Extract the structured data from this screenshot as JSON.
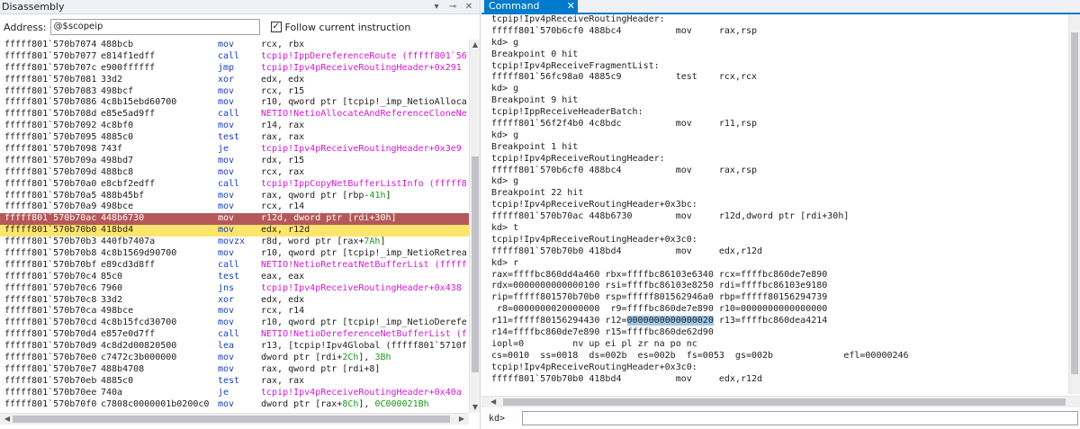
{
  "disassembly": {
    "title": "Disassembly",
    "address_label": "Address:",
    "address_value": "@$scopeip",
    "follow_label": "Follow current instruction",
    "follow_checked": "✓",
    "rows": [
      {
        "addr": "fffff801`570b7074",
        "bytes": "488bcb",
        "mn": "mov",
        "op": [
          {
            "t": "rcx, rbx",
            "c": ""
          }
        ]
      },
      {
        "addr": "fffff801`570b7077",
        "bytes": "e814f1edff",
        "mn": "call",
        "op": [
          {
            "t": "tcpip!IppDereferenceRoute (fffff801`56",
            "c": "mag"
          }
        ]
      },
      {
        "addr": "fffff801`570b707c",
        "bytes": "e900ffffff",
        "mn": "jmp",
        "op": [
          {
            "t": "tcpip!Ipv4pReceiveRoutingHeader+0x291",
            "c": "mag"
          }
        ]
      },
      {
        "addr": "fffff801`570b7081",
        "bytes": "33d2",
        "mn": "xor",
        "op": [
          {
            "t": "edx, edx",
            "c": ""
          }
        ]
      },
      {
        "addr": "fffff801`570b7083",
        "bytes": "498bcf",
        "mn": "mov",
        "op": [
          {
            "t": "rcx, r15",
            "c": ""
          }
        ]
      },
      {
        "addr": "fffff801`570b7086",
        "bytes": "4c8b15ebd60700",
        "mn": "mov",
        "op": [
          {
            "t": "r10, qword ptr [tcpip!_imp_NetioAlloca",
            "c": ""
          }
        ]
      },
      {
        "addr": "fffff801`570b708d",
        "bytes": "e85e5ad9ff",
        "mn": "call",
        "op": [
          {
            "t": "NETIO!NetioAllocateAndReferenceCloneNe",
            "c": "mag"
          }
        ]
      },
      {
        "addr": "fffff801`570b7092",
        "bytes": "4c8bf0",
        "mn": "mov",
        "op": [
          {
            "t": "r14, rax",
            "c": ""
          }
        ]
      },
      {
        "addr": "fffff801`570b7095",
        "bytes": "4885c0",
        "mn": "test",
        "op": [
          {
            "t": "rax, rax",
            "c": ""
          }
        ]
      },
      {
        "addr": "fffff801`570b7098",
        "bytes": "743f",
        "mn": "je",
        "op": [
          {
            "t": "tcpip!Ipv4pReceiveRoutingHeader+0x3e9",
            "c": "mag"
          }
        ]
      },
      {
        "addr": "fffff801`570b709a",
        "bytes": "498bd7",
        "mn": "mov",
        "op": [
          {
            "t": "rdx, r15",
            "c": ""
          }
        ]
      },
      {
        "addr": "fffff801`570b709d",
        "bytes": "488bc8",
        "mn": "mov",
        "op": [
          {
            "t": "rcx, rax",
            "c": ""
          }
        ]
      },
      {
        "addr": "fffff801`570b70a0",
        "bytes": "e8cbf2edff",
        "mn": "call",
        "op": [
          {
            "t": "tcpip!IppCopyNetBufferListInfo (fffff8",
            "c": "mag"
          }
        ]
      },
      {
        "addr": "fffff801`570b70a5",
        "bytes": "488b45bf",
        "mn": "mov",
        "op": [
          {
            "t": "rax, qword ptr [rbp-",
            "c": ""
          },
          {
            "t": "41h",
            "c": "grn"
          },
          {
            "t": "]",
            "c": ""
          }
        ]
      },
      {
        "addr": "fffff801`570b70a9",
        "bytes": "498bce",
        "mn": "mov",
        "op": [
          {
            "t": "rcx, r14",
            "c": ""
          }
        ]
      },
      {
        "addr": "fffff801`570b70ac",
        "bytes": "448b6730",
        "mn": "mov",
        "op": [
          {
            "t": "r12d, dword ptr [rdi+30h]",
            "c": ""
          }
        ],
        "state": "cur"
      },
      {
        "addr": "fffff801`570b70b0",
        "bytes": "418bd4",
        "mn": "mov",
        "op": [
          {
            "t": "edx, r12d",
            "c": ""
          }
        ],
        "state": "next"
      },
      {
        "addr": "fffff801`570b70b3",
        "bytes": "440fb7407a",
        "mn": "movzx",
        "op": [
          {
            "t": "r8d, word ptr [rax+",
            "c": ""
          },
          {
            "t": "7Ah",
            "c": "grn"
          },
          {
            "t": "]",
            "c": ""
          }
        ]
      },
      {
        "addr": "fffff801`570b70b8",
        "bytes": "4c8b1569d90700",
        "mn": "mov",
        "op": [
          {
            "t": "r10, qword ptr [tcpip!_imp_NetioRetrea",
            "c": ""
          }
        ]
      },
      {
        "addr": "fffff801`570b70bf",
        "bytes": "e89cd3d8ff",
        "mn": "call",
        "op": [
          {
            "t": "NETIO!NetioRetreatNetBufferList (fffff",
            "c": "mag"
          }
        ]
      },
      {
        "addr": "fffff801`570b70c4",
        "bytes": "85c0",
        "mn": "test",
        "op": [
          {
            "t": "eax, eax",
            "c": ""
          }
        ]
      },
      {
        "addr": "fffff801`570b70c6",
        "bytes": "7960",
        "mn": "jns",
        "op": [
          {
            "t": "tcpip!Ipv4pReceiveRoutingHeader+0x438",
            "c": "mag"
          }
        ]
      },
      {
        "addr": "fffff801`570b70c8",
        "bytes": "33d2",
        "mn": "xor",
        "op": [
          {
            "t": "edx, edx",
            "c": ""
          }
        ]
      },
      {
        "addr": "fffff801`570b70ca",
        "bytes": "498bce",
        "mn": "mov",
        "op": [
          {
            "t": "rcx, r14",
            "c": ""
          }
        ]
      },
      {
        "addr": "fffff801`570b70cd",
        "bytes": "4c8b15fcd30700",
        "mn": "mov",
        "op": [
          {
            "t": "r10, qword ptr [tcpip!_imp_NetioDerefe",
            "c": ""
          }
        ]
      },
      {
        "addr": "fffff801`570b70d4",
        "bytes": "e857e0d7ff",
        "mn": "call",
        "op": [
          {
            "t": "NETIO!NetioDereferenceNetBufferList (f",
            "c": "mag"
          }
        ]
      },
      {
        "addr": "fffff801`570b70d9",
        "bytes": "4c8d2d00820500",
        "mn": "lea",
        "op": [
          {
            "t": "r13, [tcpip!Ipv4Global (fffff801`5710f",
            "c": ""
          }
        ]
      },
      {
        "addr": "fffff801`570b70e0",
        "bytes": "c7472c3b000000",
        "mn": "mov",
        "op": [
          {
            "t": "dword ptr [rdi+",
            "c": ""
          },
          {
            "t": "2Ch",
            "c": "grn"
          },
          {
            "t": "], ",
            "c": ""
          },
          {
            "t": "3Bh",
            "c": "grn"
          }
        ]
      },
      {
        "addr": "fffff801`570b70e7",
        "bytes": "488b4708",
        "mn": "mov",
        "op": [
          {
            "t": "rax, qword ptr [rdi+8]",
            "c": ""
          }
        ]
      },
      {
        "addr": "fffff801`570b70eb",
        "bytes": "4885c0",
        "mn": "test",
        "op": [
          {
            "t": "rax, rax",
            "c": ""
          }
        ]
      },
      {
        "addr": "fffff801`570b70ee",
        "bytes": "740a",
        "mn": "je",
        "op": [
          {
            "t": "tcpip!Ipv4pReceiveRoutingHeader+0x40a",
            "c": "mag"
          }
        ]
      },
      {
        "addr": "fffff801`570b70f0",
        "bytes": "c7808c0000001b0200c0",
        "mn": "mov",
        "op": [
          {
            "t": "dword ptr [rax+",
            "c": ""
          },
          {
            "t": "8Ch",
            "c": "grn"
          },
          {
            "t": "], ",
            "c": ""
          },
          {
            "t": "0C000021Bh",
            "c": "grn"
          }
        ]
      }
    ]
  },
  "command": {
    "tab_label": "Command",
    "close_glyph": "✕",
    "prompt": "kd>",
    "lines": [
      [
        {
          "t": "tcpip!Ipv4pReceiveRoutingHeader:"
        }
      ],
      [
        {
          "t": "fffff801`570b6cf0 488bc4          mov     rax,rsp"
        }
      ],
      [
        {
          "t": "kd> g"
        }
      ],
      [
        {
          "t": "Breakpoint 0 hit"
        }
      ],
      [
        {
          "t": "tcpip!Ipv4pReceiveFragmentList:"
        }
      ],
      [
        {
          "t": "fffff801`56fc98a0 4885c9          test    rcx,rcx"
        }
      ],
      [
        {
          "t": "kd> g"
        }
      ],
      [
        {
          "t": "Breakpoint 9 hit"
        }
      ],
      [
        {
          "t": "tcpip!IppReceiveHeaderBatch:"
        }
      ],
      [
        {
          "t": "fffff801`56f2f4b0 4c8bdc          mov     r11,rsp"
        }
      ],
      [
        {
          "t": "kd> g"
        }
      ],
      [
        {
          "t": "Breakpoint 1 hit"
        }
      ],
      [
        {
          "t": "tcpip!Ipv4pReceiveRoutingHeader:"
        }
      ],
      [
        {
          "t": "fffff801`570b6cf0 488bc4          mov     rax,rsp"
        }
      ],
      [
        {
          "t": "kd> g"
        }
      ],
      [
        {
          "t": "Breakpoint 22 hit"
        }
      ],
      [
        {
          "t": "tcpip!Ipv4pReceiveRoutingHeader+0x3bc:"
        }
      ],
      [
        {
          "t": "fffff801`570b70ac 448b6730        mov     r12d,dword ptr [rdi+30h]"
        }
      ],
      [
        {
          "t": "kd> t"
        }
      ],
      [
        {
          "t": "tcpip!Ipv4pReceiveRoutingHeader+0x3c0:"
        }
      ],
      [
        {
          "t": "fffff801`570b70b0 418bd4          mov     edx,r12d"
        }
      ],
      [
        {
          "t": "kd> r"
        }
      ],
      [
        {
          "t": "rax=ffffbc860dd4a460 rbx=ffffbc86103e6340 rcx=ffffbc860de7e890"
        }
      ],
      [
        {
          "t": "rdx=0000000000000100 rsi=ffffbc86103e8250 rdi=ffffbc86103e9180"
        }
      ],
      [
        {
          "t": "rip=fffff801570b70b0 rsp=fffff801562946a0 rbp=fffff80156294739"
        }
      ],
      [
        {
          "t": " r8=0000000020000000  r9=ffffbc860de7e890 r10=0000000000000000"
        }
      ],
      [
        {
          "t": "r11=fffff80156294430 r12="
        },
        {
          "t": "0000000000000020",
          "hl": true
        },
        {
          "t": " r13=ffffbc860dea4214"
        }
      ],
      [
        {
          "t": "r14=ffffbc860de7e890 r15=ffffbc860de62d90"
        }
      ],
      [
        {
          "t": "iopl=0         nv up ei pl zr na po nc"
        }
      ],
      [
        {
          "t": "cs=0010  ss=0018  ds=002b  es=002b  fs=0053  gs=002b             efl=00000246"
        }
      ],
      [
        {
          "t": "tcpip!Ipv4pReceiveRoutingHeader+0x3c0:"
        }
      ],
      [
        {
          "t": "fffff801`570b70b0 418bd4          mov     edx,r12d"
        }
      ]
    ]
  },
  "icons": {
    "dropdown": "▾",
    "pin": "⊸",
    "close": "✕",
    "scroll_up": "▲",
    "scroll_down": "▼",
    "scroll_left": "◀",
    "scroll_right": "▶"
  },
  "colors": {
    "current_line": "#b5585c",
    "next_line": "#ffe56b",
    "mnemonic": "#1a40c8",
    "symbol": "#d418d4",
    "immediate": "#1a9a1a",
    "tab_accent": "#007acc",
    "selection": "#9fc8ea"
  }
}
